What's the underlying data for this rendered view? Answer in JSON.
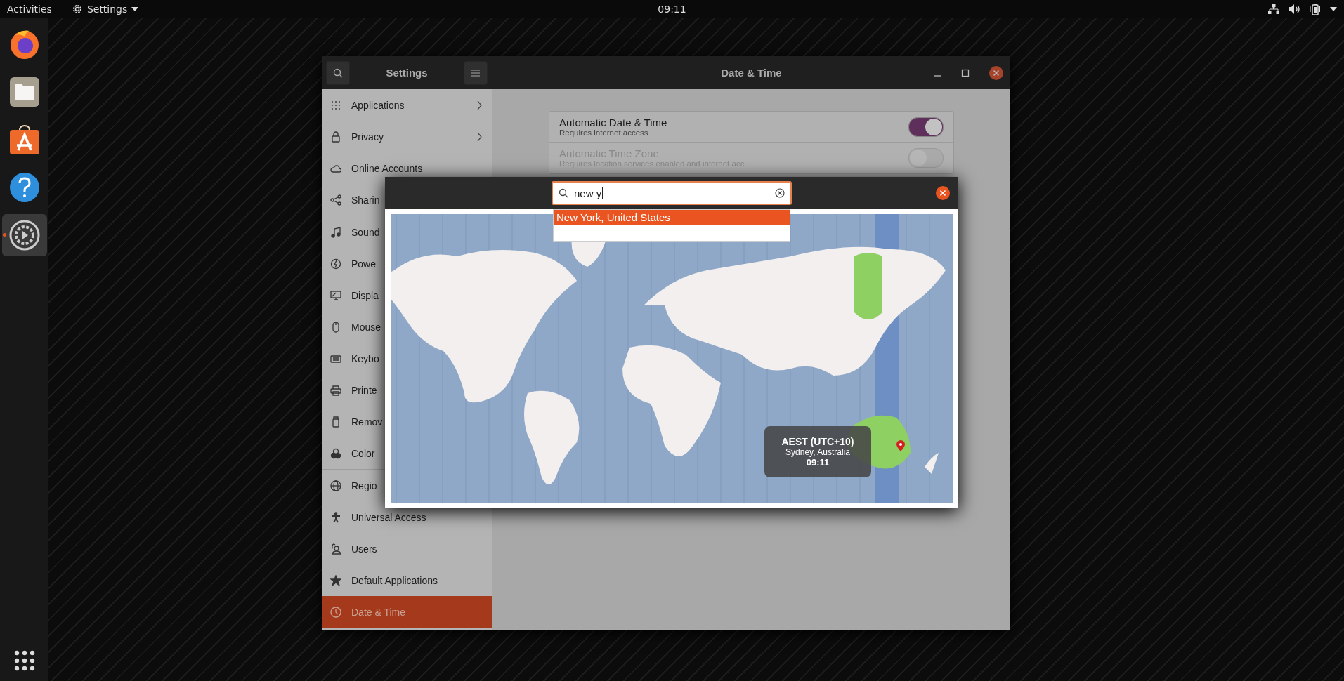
{
  "top_bar": {
    "activities": "Activities",
    "app_menu": "Settings",
    "clock": "09:11"
  },
  "dock": {
    "apps": [
      {
        "kind": "browser",
        "running": false
      },
      {
        "kind": "files",
        "running": false
      },
      {
        "kind": "store",
        "running": false
      },
      {
        "kind": "help",
        "running": false
      },
      {
        "kind": "settings",
        "running": true
      }
    ]
  },
  "window": {
    "sidebar_title": "Settings",
    "title": "Date & Time"
  },
  "sidebar": {
    "groups": [
      [
        {
          "kind": "grid",
          "label": "Applications",
          "chevron": true,
          "selected": false
        },
        {
          "kind": "lock",
          "label": "Privacy",
          "chevron": true,
          "selected": false
        },
        {
          "kind": "cloud",
          "label": "Online Accounts",
          "chevron": false,
          "selected": false
        },
        {
          "kind": "share",
          "label": "Sharin",
          "chevron": false,
          "selected": false
        }
      ],
      [
        {
          "kind": "music",
          "label": "Sound",
          "chevron": false,
          "selected": false
        },
        {
          "kind": "power",
          "label": "Powe",
          "chevron": false,
          "selected": false
        },
        {
          "kind": "display",
          "label": "Displa",
          "chevron": false,
          "selected": false
        },
        {
          "kind": "mouse",
          "label": "Mouse",
          "chevron": false,
          "selected": false
        },
        {
          "kind": "keyboard",
          "label": "Keybo",
          "chevron": false,
          "selected": false
        },
        {
          "kind": "printer",
          "label": "Printe",
          "chevron": false,
          "selected": false
        },
        {
          "kind": "usb",
          "label": "Remov",
          "chevron": false,
          "selected": false
        },
        {
          "kind": "color",
          "label": "Color",
          "chevron": false,
          "selected": false
        }
      ],
      [
        {
          "kind": "globe",
          "label": "Regio",
          "chevron": false,
          "selected": false
        },
        {
          "kind": "person",
          "label": "Universal Access",
          "chevron": false,
          "selected": false
        },
        {
          "kind": "users",
          "label": "Users",
          "chevron": false,
          "selected": false
        },
        {
          "kind": "star",
          "label": "Default Applications",
          "chevron": false,
          "selected": false
        },
        {
          "kind": "clock",
          "label": "Date & Time",
          "chevron": false,
          "selected": true
        }
      ]
    ]
  },
  "settings": [
    {
      "title": "Automatic Date & Time",
      "subtitle": "Requires internet access",
      "on": true,
      "disabled": false
    },
    {
      "title": "Automatic Time Zone",
      "subtitle": "Requires location services enabled and internet acc",
      "on": false,
      "disabled": true
    }
  ],
  "timezone_dialog": {
    "search": {
      "value": "new y"
    },
    "results": [
      {
        "label": "New York, United States",
        "selected": true
      }
    ],
    "tooltip": {
      "zone": "AEST (UTC+10)",
      "city": "Sydney, Australia",
      "time": "09:11"
    }
  }
}
